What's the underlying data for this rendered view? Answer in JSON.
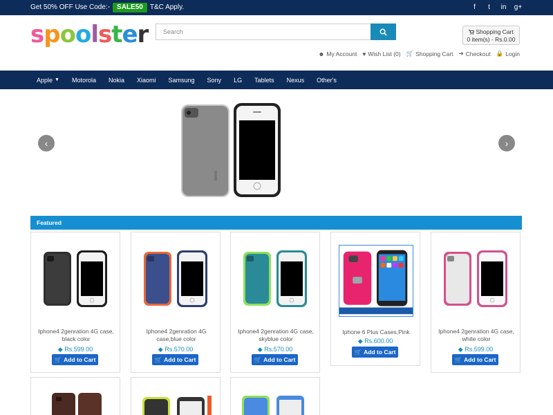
{
  "promo": {
    "text": "Get 50% OFF Use Code:-",
    "code": "SALE50",
    "suffix": "T&C Apply."
  },
  "social": [
    "f",
    "t",
    "in",
    "g+"
  ],
  "logo": [
    "s",
    "p",
    "o",
    "o",
    "l",
    "s",
    "t",
    "e",
    "r"
  ],
  "search": {
    "placeholder": "Search"
  },
  "cart_box": {
    "title": "Shopping Cart",
    "summary": "0 item(s) - Rs.0.00"
  },
  "account_links": [
    {
      "label": "My Account",
      "icon": "user-icon"
    },
    {
      "label": "Wish List (0)",
      "icon": "heart-icon"
    },
    {
      "label": "Shopping Cart",
      "icon": "cart-icon"
    },
    {
      "label": "Checkout",
      "icon": "checkout-icon"
    },
    {
      "label": "Login",
      "icon": "lock-icon"
    }
  ],
  "nav": [
    "Apple",
    "Motorola",
    "Nokia",
    "Xiaomi",
    "Samsung",
    "Sony",
    "LG",
    "Tablets",
    "Nexus",
    "Other's"
  ],
  "featured_title": "Featured",
  "products": [
    {
      "name": "Iphone4 2genration 4G case, black color",
      "price": "Rs.599.00",
      "button": "Add to Cart",
      "case_color": "#2f2f2f",
      "accent": "#1e1e1e"
    },
    {
      "name": "Iphone4 2genration 4G case,blue color",
      "price": "Rs.570.00",
      "button": "Add to Cart",
      "case_color": "#3a4f8c",
      "accent": "#e8683a"
    },
    {
      "name": "Iphone4 2genration 4G case, skyblue color",
      "price": "Rs.570.00",
      "button": "Add to Cart",
      "case_color": "#2a8a97",
      "accent": "#8ee05a"
    },
    {
      "name": "Iphone 6 Plus Cases,Pink",
      "price": "Rs.600.00",
      "button": "Add to Cart",
      "case_color": "#e8246f",
      "accent": "#2a8ae0"
    },
    {
      "name": "Iphone4 2genration 4G case, white color",
      "price": "Rs.599.00",
      "button": "Add to Cart",
      "case_color": "#e8e8e8",
      "accent": "#d4508a"
    }
  ]
}
